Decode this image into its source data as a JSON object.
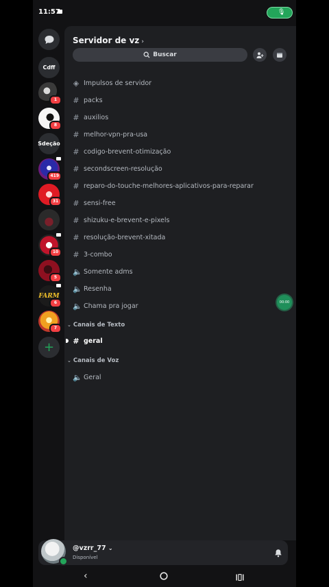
{
  "status": {
    "time": "11:57"
  },
  "rail": {
    "servers": [
      {
        "kind": "text",
        "label": "Cdff",
        "badge": ""
      },
      {
        "kind": "image",
        "label": "",
        "badge": "1"
      },
      {
        "kind": "image",
        "label": "",
        "badge": "8"
      },
      {
        "kind": "text",
        "label": "Sdeção",
        "badge": ""
      },
      {
        "kind": "image",
        "label": "",
        "badge": "419"
      },
      {
        "kind": "image",
        "label": "",
        "badge": "31"
      },
      {
        "kind": "image",
        "label": "",
        "badge": ""
      },
      {
        "kind": "image",
        "label": "",
        "badge": "10"
      },
      {
        "kind": "image",
        "label": "",
        "badge": "5"
      },
      {
        "kind": "image",
        "label": "FARM",
        "badge": "6"
      },
      {
        "kind": "image",
        "label": "",
        "badge": "7"
      }
    ],
    "add_icon": "plus-icon"
  },
  "server": {
    "name": "Servidor de vz",
    "search_label": "Buscar"
  },
  "channels": [
    {
      "icon": "boost-icon",
      "name": "Impulsos de servidor"
    },
    {
      "icon": "hash-icon",
      "name": "packs"
    },
    {
      "icon": "hash-icon",
      "name": "auxilios"
    },
    {
      "icon": "hash-icon",
      "name": "melhor-vpn-pra-usa"
    },
    {
      "icon": "hash-icon",
      "name": "codigo-brevent-otimização"
    },
    {
      "icon": "hash-icon",
      "name": "secondscreen-resolução"
    },
    {
      "icon": "hash-icon",
      "name": "reparo-do-touche-melhores-aplicativos-para-reparar"
    },
    {
      "icon": "hash-icon",
      "name": "sensi-free"
    },
    {
      "icon": "hash-icon",
      "name": "shizuku-e-brevent-e-pixels"
    },
    {
      "icon": "hash-icon",
      "name": "resolução-brevent-xitada"
    },
    {
      "icon": "hash-icon",
      "name": "3-combo"
    },
    {
      "icon": "voice-locked-icon",
      "name": "Somente adms"
    },
    {
      "icon": "speaker-icon",
      "name": "Resenha"
    },
    {
      "icon": "speaker-icon",
      "name": "Chama pra jogar"
    }
  ],
  "categories": {
    "text": {
      "title": "Canais de Texto",
      "channel": "geral"
    },
    "voice": {
      "title": "Canais de Voz",
      "channel": "Geral"
    }
  },
  "floating_timer": "00:00",
  "user": {
    "handle": "@vzrr_77",
    "status": "Disponível"
  },
  "colors": {
    "accent_green": "#23a55a",
    "badge_red": "#f23f43",
    "panel_bg": "#1e1f22"
  }
}
